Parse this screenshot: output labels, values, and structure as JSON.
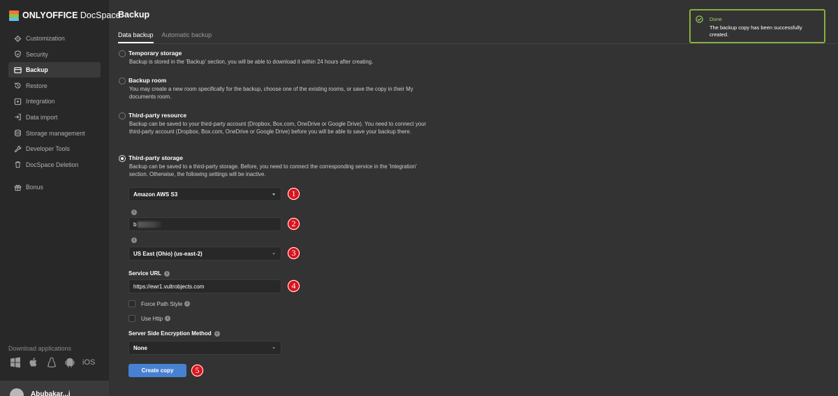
{
  "app": {
    "logo_brand": "ONLYOFFICE",
    "logo_product": "DocSpace"
  },
  "sidebar": {
    "items": [
      {
        "label": "Customization",
        "icon": "customization-icon"
      },
      {
        "label": "Security",
        "icon": "shield-icon"
      },
      {
        "label": "Backup",
        "icon": "backup-icon",
        "active": true
      },
      {
        "label": "Restore",
        "icon": "restore-icon"
      },
      {
        "label": "Integration",
        "icon": "integration-icon"
      },
      {
        "label": "Data import",
        "icon": "import-icon"
      },
      {
        "label": "Storage management",
        "icon": "storage-icon"
      },
      {
        "label": "Developer Tools",
        "icon": "wrench-icon"
      },
      {
        "label": "DocSpace Deletion",
        "icon": "trash-icon"
      }
    ],
    "bonus_label": "Bonus",
    "download_label": "Download applications",
    "ios_label": "iOS",
    "user_name": "Abubakar...i"
  },
  "main": {
    "title": "Backup",
    "tabs": [
      {
        "label": "Data backup",
        "active": true
      },
      {
        "label": "Automatic backup",
        "active": false
      }
    ],
    "options": [
      {
        "title": "Temporary storage",
        "desc": "Backup is stored in the 'Backup' section, you will be able to download it within 24 hours after creating.",
        "checked": false
      },
      {
        "title": "Backup room",
        "desc": "You may create a new room specifically for the backup, choose one of the existing rooms, or save the copy in their My documents room.",
        "checked": false
      },
      {
        "title": "Third-party resource",
        "desc": "Backup can be saved to your third-party account (Dropbox, Box.com, OneDrive or Google Drive). You need to connect your third-party account (Dropbox, Box.com, OneDrive or Google Drive) before you will be able to save your backup there.",
        "checked": false
      },
      {
        "title": "Third-party storage",
        "desc": "Backup can be saved to a third-party storage. Before, you need to connect the corresponding service in the 'Integration' section. Otherwise, the following settings will be inactive.",
        "checked": true
      }
    ],
    "form": {
      "storage_select": "Amazon AWS S3",
      "bucket_value": "b",
      "region_select": "US East (Ohio) (us-east-2)",
      "service_url_label": "Service URL",
      "service_url_value": "https://ewr1.vultrobjects.com",
      "force_path_style_label": "Force Path Style",
      "use_http_label": "Use Http",
      "sse_label": "Server Side Encryption Method",
      "sse_select": "None",
      "create_button": "Create copy"
    },
    "badges": [
      "1",
      "2",
      "3",
      "4",
      "5"
    ],
    "info_glyph": "i"
  },
  "toast": {
    "title": "Done",
    "message": "The backup copy has been successfully created."
  },
  "colors": {
    "accent_blue": "#4781d1",
    "success_green": "#86b13b",
    "badge_red": "#d8141c"
  }
}
